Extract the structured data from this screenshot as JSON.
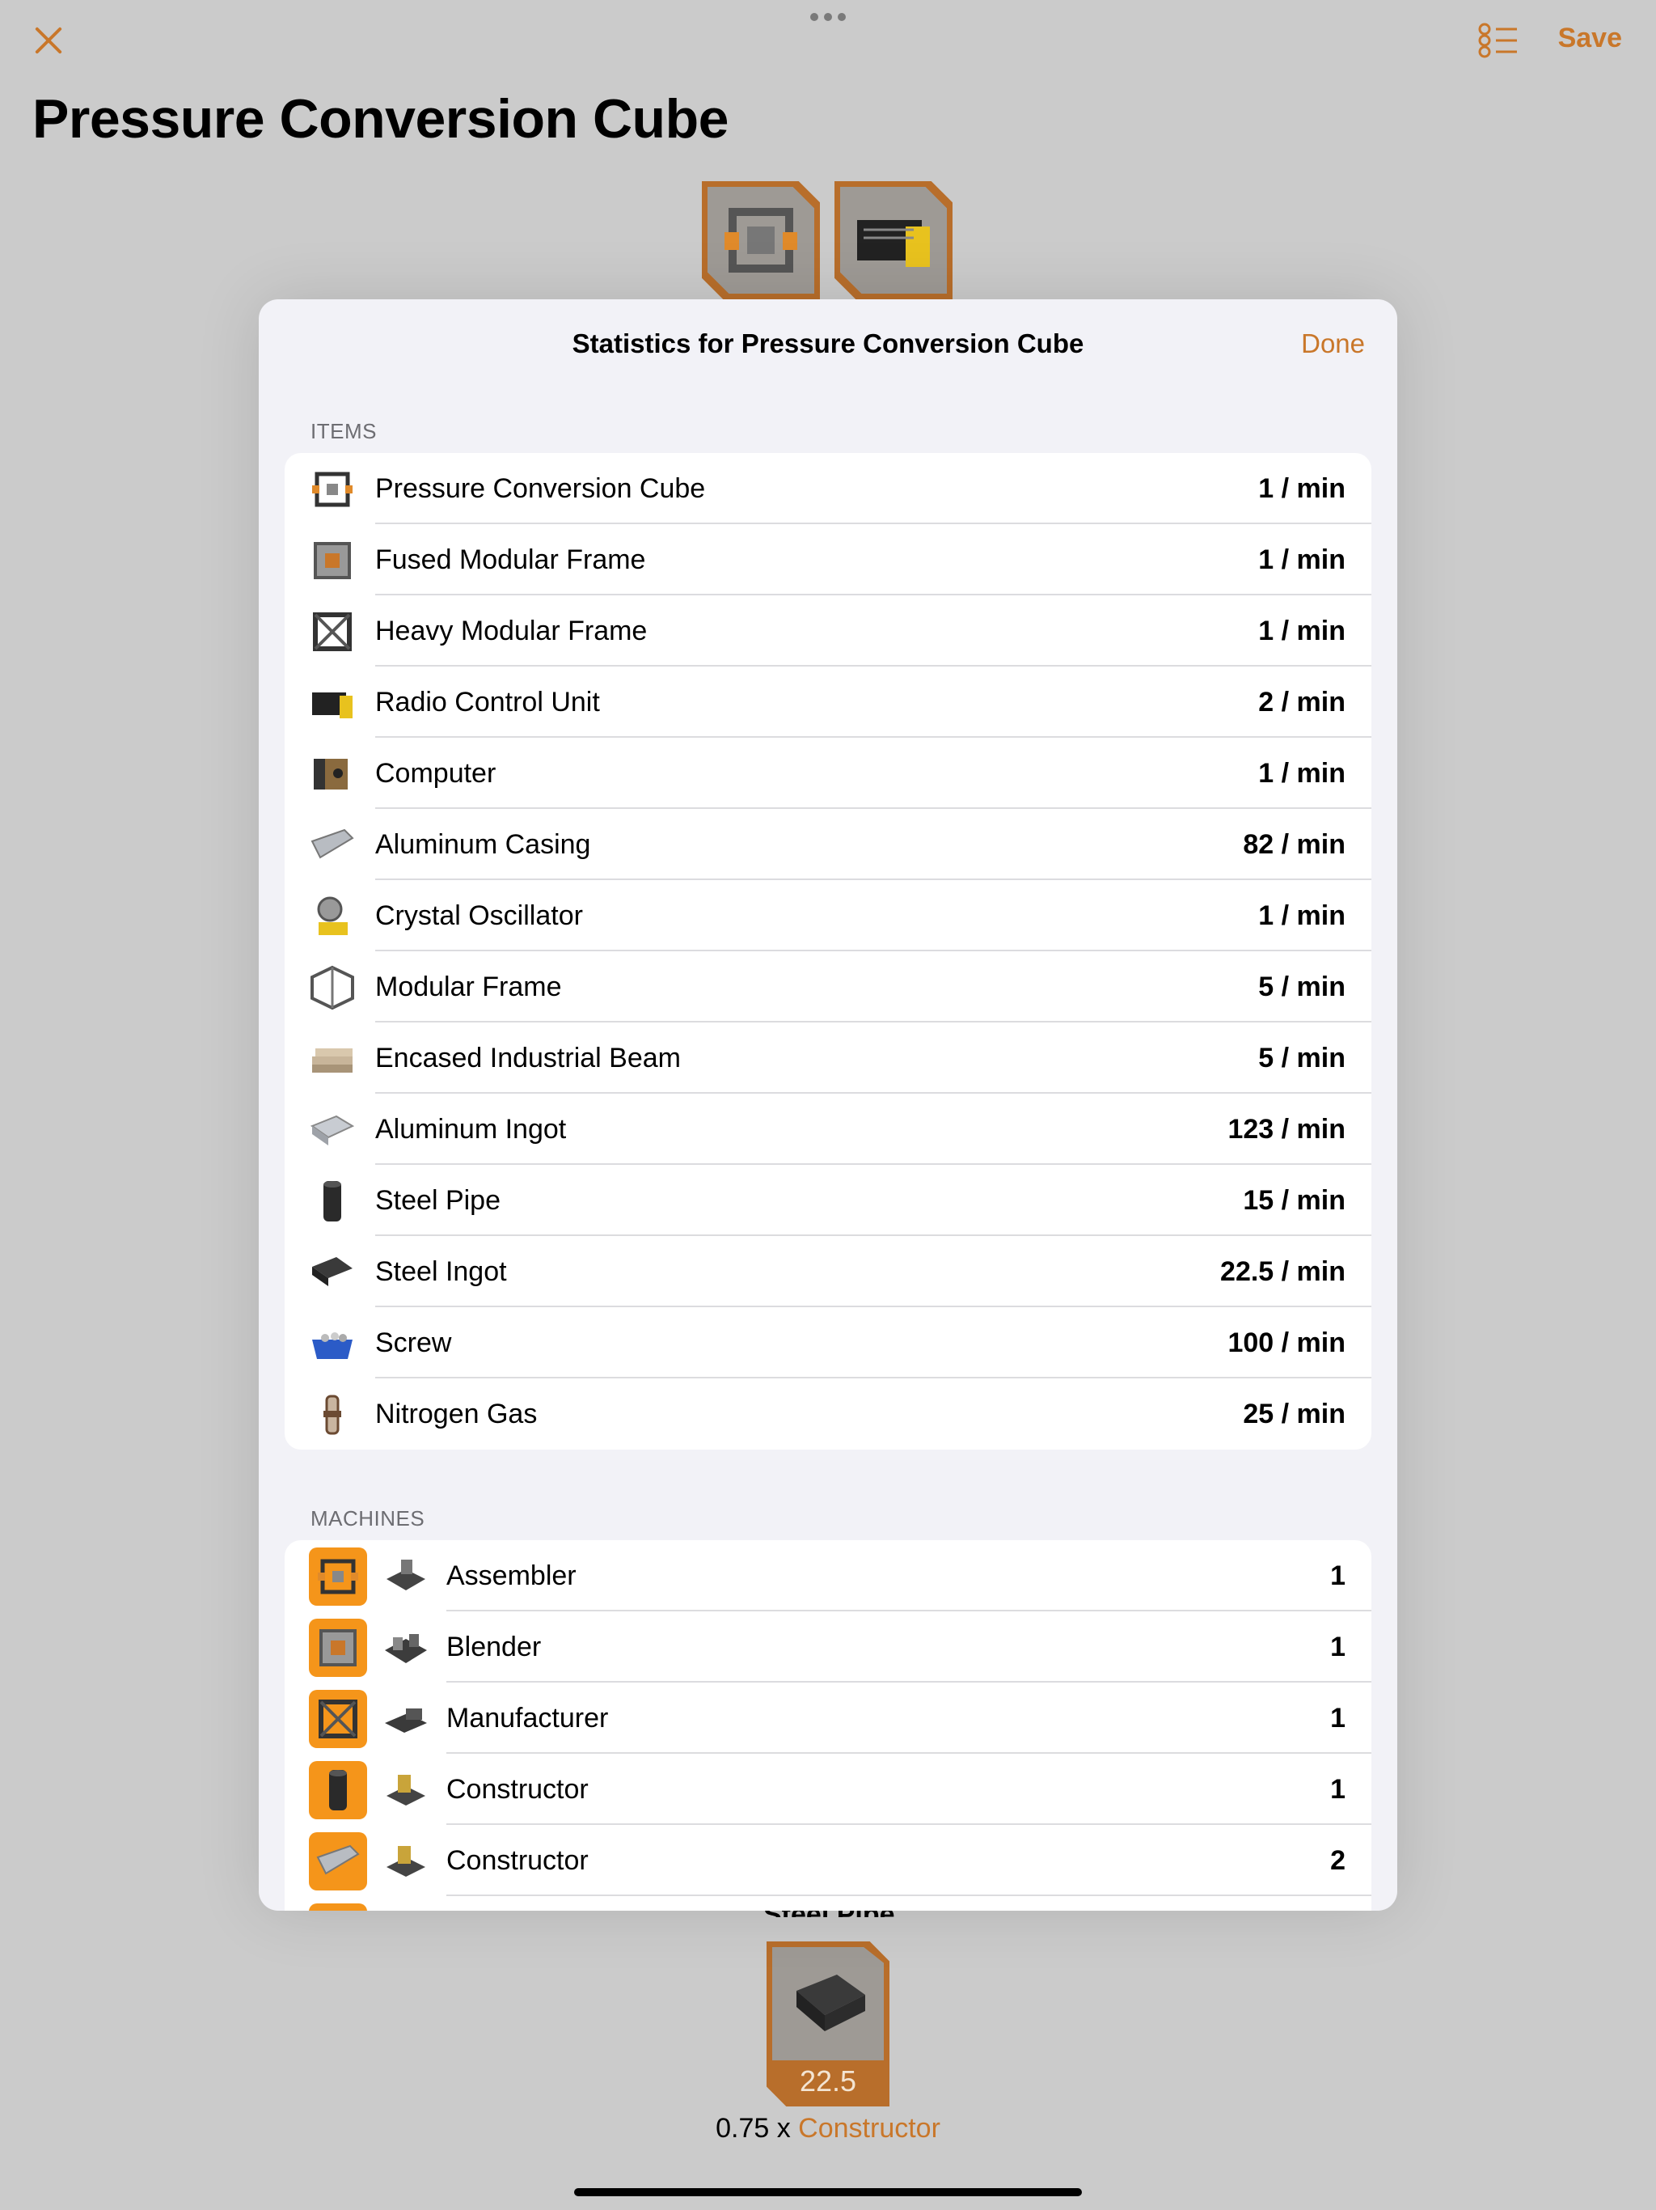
{
  "toolbar": {
    "save_label": "Save"
  },
  "page": {
    "title": "Pressure Conversion Cube"
  },
  "modal": {
    "title": "Statistics for Pressure Conversion Cube",
    "done_label": "Done",
    "items_header": "ITEMS",
    "machines_header": "MACHINES"
  },
  "items": [
    {
      "name": "Pressure Conversion Cube",
      "rate": "1 / min",
      "icon": "pressure-cube-icon"
    },
    {
      "name": "Fused Modular Frame",
      "rate": "1 / min",
      "icon": "fused-frame-icon"
    },
    {
      "name": "Heavy Modular Frame",
      "rate": "1 / min",
      "icon": "heavy-frame-icon"
    },
    {
      "name": "Radio Control Unit",
      "rate": "2 / min",
      "icon": "radio-unit-icon"
    },
    {
      "name": "Computer",
      "rate": "1 / min",
      "icon": "computer-icon"
    },
    {
      "name": "Aluminum Casing",
      "rate": "82 / min",
      "icon": "aluminum-casing-icon"
    },
    {
      "name": "Crystal Oscillator",
      "rate": "1 / min",
      "icon": "crystal-oscillator-icon"
    },
    {
      "name": "Modular Frame",
      "rate": "5 / min",
      "icon": "modular-frame-icon"
    },
    {
      "name": "Encased Industrial Beam",
      "rate": "5 / min",
      "icon": "industrial-beam-icon"
    },
    {
      "name": "Aluminum Ingot",
      "rate": "123 / min",
      "icon": "aluminum-ingot-icon"
    },
    {
      "name": "Steel Pipe",
      "rate": "15 / min",
      "icon": "steel-pipe-icon"
    },
    {
      "name": "Steel Ingot",
      "rate": "22.5 / min",
      "icon": "steel-ingot-icon"
    },
    {
      "name": "Screw",
      "rate": "100 / min",
      "icon": "screw-icon"
    },
    {
      "name": "Nitrogen Gas",
      "rate": "25 / min",
      "icon": "nitrogen-gas-icon"
    }
  ],
  "machines": [
    {
      "name": "Assembler",
      "count": "1",
      "product_icon": "pressure-cube-icon",
      "machine_icon": "assembler-icon"
    },
    {
      "name": "Blender",
      "count": "1",
      "product_icon": "fused-frame-icon",
      "machine_icon": "blender-icon"
    },
    {
      "name": "Manufacturer",
      "count": "1",
      "product_icon": "heavy-frame-icon",
      "machine_icon": "manufacturer-icon"
    },
    {
      "name": "Constructor",
      "count": "1",
      "product_icon": "steel-pipe-icon",
      "machine_icon": "constructor-icon"
    },
    {
      "name": "Constructor",
      "count": "2",
      "product_icon": "aluminum-casing-icon",
      "machine_icon": "constructor-icon"
    }
  ],
  "background": {
    "bottom_label": "Steel Pipe",
    "bottom_qty": "22.5",
    "bottom_multiplier": "0.75 x",
    "bottom_machine": "Constructor"
  },
  "colors": {
    "accent": "#c9772a",
    "tile": "#b86e2b",
    "badge": "#f5951a"
  }
}
